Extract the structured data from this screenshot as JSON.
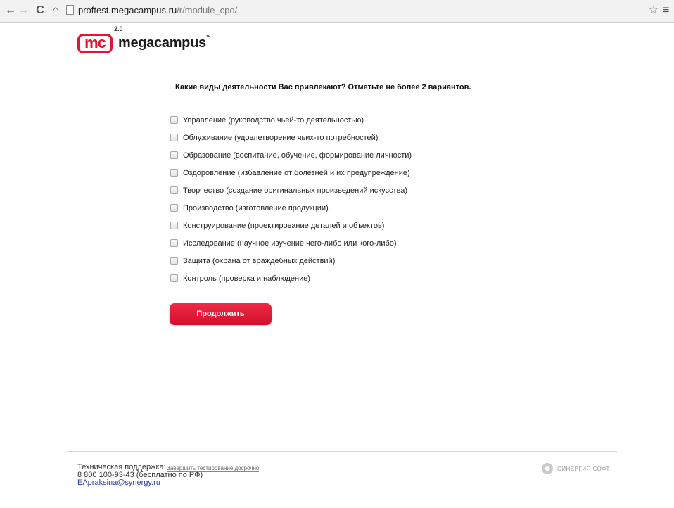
{
  "browser": {
    "url_host": "proftest.megacampus.ru",
    "url_path": "/r/module_cpo/"
  },
  "logo": {
    "mark": "mc",
    "version": "2.0",
    "word": "megacampus",
    "tm": "™"
  },
  "question": "Какие виды деятельности Вас привлекают? Отметьте не более 2 вариантов.",
  "options": [
    {
      "label": "Управление (руководство чьей-то деятельностью)",
      "checked": false
    },
    {
      "label": "Облуживание (удовлетворение чьих-то потребностей)",
      "checked": false
    },
    {
      "label": "Образование (воспитание, обучение, формирование личности)",
      "checked": false
    },
    {
      "label": "Оздоровление (избавление от болезней и их предупреждение)",
      "checked": false
    },
    {
      "label": "Творчество (создание оригинальных произведений искусства)",
      "checked": false
    },
    {
      "label": "Производство (изготовление продукции)",
      "checked": false
    },
    {
      "label": "Конструирование (проектирование деталей и объектов)",
      "checked": false
    },
    {
      "label": "Исследование (научное изучение чего-либо или кого-либо)",
      "checked": false
    },
    {
      "label": "Защита (охрана от враждебных действий)",
      "checked": false
    },
    {
      "label": "Контроль (проверка и наблюдение)",
      "checked": false
    }
  ],
  "continue_label": "Продолжить",
  "footer": {
    "support_title": "Техническая поддержка:",
    "finish_link": "Завершить тестирование досрочно",
    "phone": "8 800 100-93-43 (бесплатно по РФ)",
    "email": "EApraksina@synergy.ru",
    "brand": "СИНЕРГИЯ СОФТ"
  },
  "colors": {
    "accent": "#e3162f",
    "link": "#2a3aa5"
  }
}
